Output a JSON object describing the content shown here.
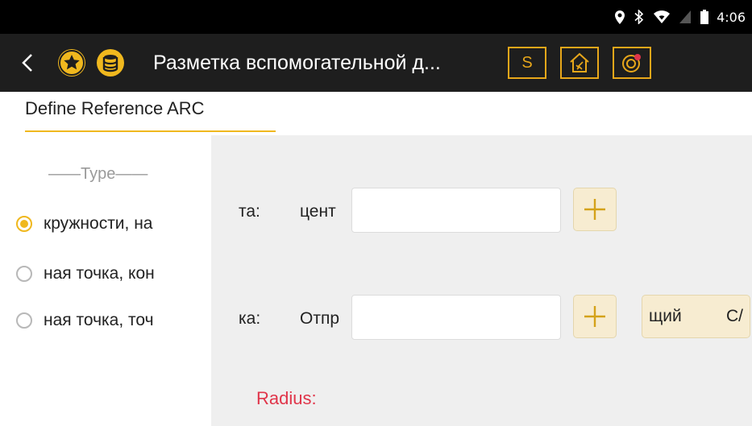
{
  "status_bar": {
    "time": "4:06",
    "icons": [
      "location-icon",
      "bluetooth-icon",
      "wifi-icon",
      "signal-icon",
      "battery-icon"
    ]
  },
  "app_bar": {
    "title": "Разметка вспомогательной д...",
    "s_button_label": "S",
    "accent_color": "#f0b81e",
    "background_color": "#1e1e1e"
  },
  "tab": {
    "label": "Define Reference ARC"
  },
  "type_section": {
    "label": "——Type——",
    "options": [
      {
        "label": "кружности, на",
        "selected": true
      },
      {
        "label": "ная точка, кон",
        "selected": false
      },
      {
        "label": "ная точка, точ",
        "selected": false
      }
    ]
  },
  "form": {
    "row1": {
      "label_a": "та:",
      "label_b": "цент",
      "value": ""
    },
    "row2": {
      "label_a": "ка:",
      "label_b": "Отпр",
      "value": "",
      "button_left": "щий",
      "button_right": "С/"
    },
    "radius_label": "Radius:",
    "radius_color": "#e0354a"
  }
}
